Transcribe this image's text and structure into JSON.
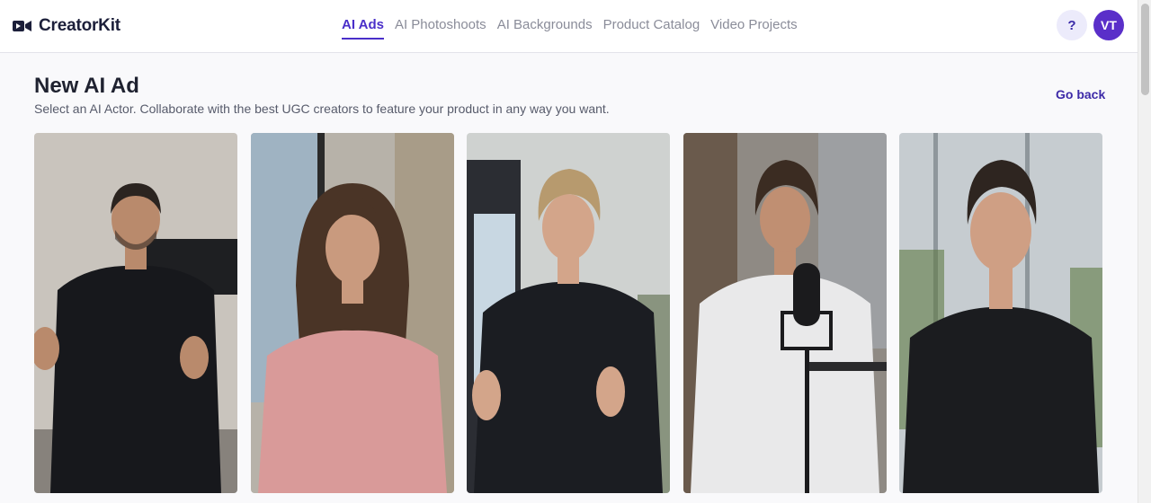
{
  "app": {
    "name": "CreatorKit",
    "logo_icon": "video-camera-icon",
    "brand_color": "#4a2fc9"
  },
  "nav": {
    "tabs": [
      {
        "label": "AI Ads",
        "active": true
      },
      {
        "label": "AI Photoshoots",
        "active": false
      },
      {
        "label": "AI Backgrounds",
        "active": false
      },
      {
        "label": "Product Catalog",
        "active": false
      },
      {
        "label": "Video Projects",
        "active": false
      }
    ]
  },
  "header": {
    "help_label": "?",
    "avatar_initials": "VT"
  },
  "page": {
    "title": "New AI Ad",
    "subtitle": "Select an AI Actor. Collaborate with the best UGC creators to feature your product in any way you want.",
    "go_back_label": "Go back"
  },
  "actors": [
    {
      "icon": "actor-photo",
      "background": "#c9c4bd",
      "shirt": "#17181c",
      "hair": "#2b2420",
      "skin": "#b98a6c"
    },
    {
      "icon": "actor-photo",
      "background": "#b7b2a9",
      "shirt": "#d99a99",
      "hair": "#4a3426",
      "skin": "#c99a7e"
    },
    {
      "icon": "actor-photo",
      "background": "#cfd2d0",
      "shirt": "#1b1d22",
      "hair": "#b79a6e",
      "skin": "#d3a58a"
    },
    {
      "icon": "actor-photo",
      "background": "#8f8a84",
      "shirt": "#e9e9ea",
      "hair": "#3b2c22",
      "skin": "#c08f72"
    },
    {
      "icon": "actor-photo",
      "background": "#c6ccd0",
      "shirt": "#1b1c1f",
      "hair": "#2e2520",
      "skin": "#cf9f84"
    }
  ]
}
